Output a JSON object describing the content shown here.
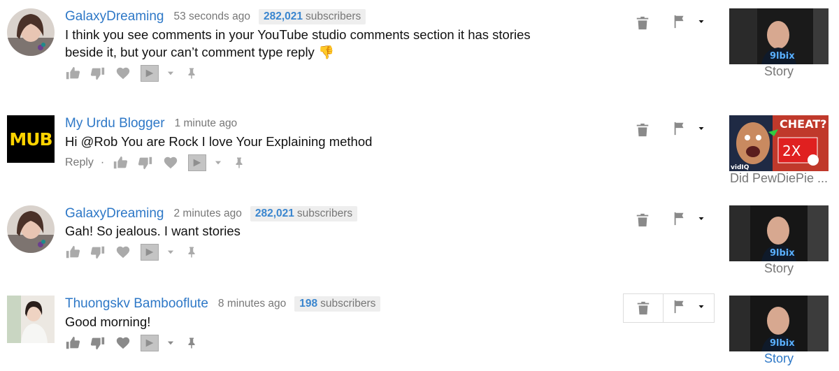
{
  "comments": [
    {
      "author": "GalaxyDreaming",
      "time": "53 seconds ago",
      "subs_count": "282,021",
      "subs_label": "subscribers",
      "text": "I think you see comments in your YouTube studio comments section it has stories beside it, but your can’t comment type reply 👎",
      "reply_label": "",
      "video_title": "Story"
    },
    {
      "author": "My Urdu Blogger",
      "time": "1 minute ago",
      "text": "Hi @Rob You are Rock I love Your Explaining method",
      "reply_label": "Reply",
      "avatar_text": "MUB",
      "video_title": "Did PewDiePie ...",
      "thumb_text_top": "CHEAT?",
      "thumb_text_mid": "2X",
      "thumb_brand": "vidIQ"
    },
    {
      "author": "GalaxyDreaming",
      "time": "2 minutes ago",
      "subs_count": "282,021",
      "subs_label": "subscribers",
      "text": "Gah! So jealous. I want stories",
      "video_title": "Story"
    },
    {
      "author": "Thuongskv Bambooflute",
      "time": "8 minutes ago",
      "subs_count": "198",
      "subs_label": "subscribers",
      "text": "Good morning!",
      "video_title": "Story"
    }
  ],
  "icons": {
    "like": "thumbs-up-icon",
    "dislike": "thumbs-down-icon",
    "heart": "heart-icon",
    "vidiq": "vidiq-icon",
    "more": "caret-down-icon",
    "pin": "pin-icon",
    "delete": "trash-icon",
    "flag": "flag-icon"
  },
  "colors": {
    "author": "#2e78c7",
    "icon": "#aaaaaa",
    "subs_badge_bg": "#eeeeee"
  }
}
